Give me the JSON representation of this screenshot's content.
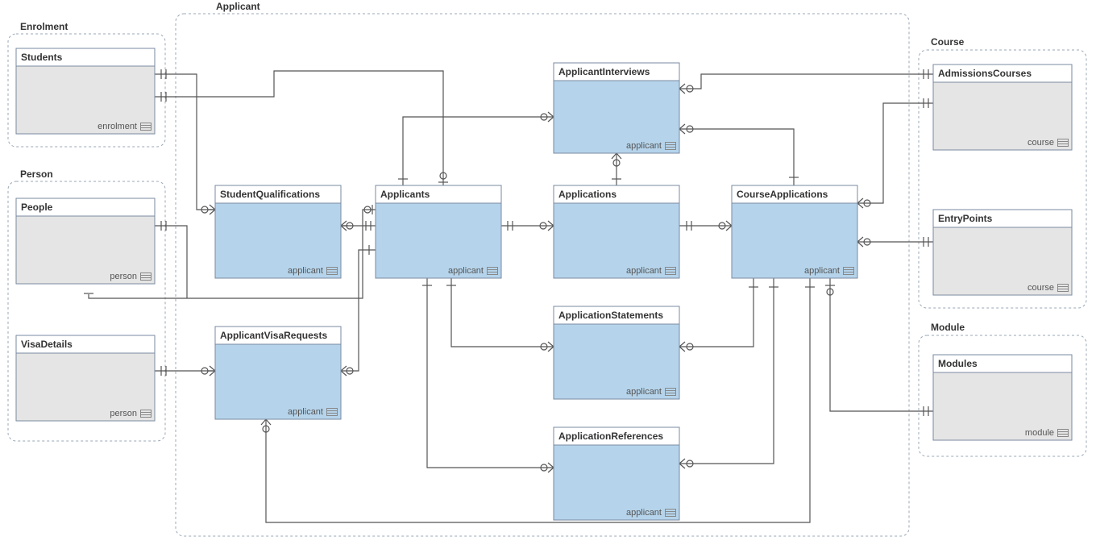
{
  "groups": {
    "enrolment": {
      "label": "Enrolment"
    },
    "person": {
      "label": "Person"
    },
    "applicant": {
      "label": "Applicant"
    },
    "course": {
      "label": "Course"
    },
    "module": {
      "label": "Module"
    }
  },
  "entities": {
    "students": {
      "title": "Students",
      "schema": "enrolment"
    },
    "people": {
      "title": "People",
      "schema": "person"
    },
    "visaDetails": {
      "title": "VisaDetails",
      "schema": "person"
    },
    "studentQualifications": {
      "title": "StudentQualifications",
      "schema": "applicant"
    },
    "applicants": {
      "title": "Applicants",
      "schema": "applicant"
    },
    "applicantVisaRequests": {
      "title": "ApplicantVisaRequests",
      "schema": "applicant"
    },
    "applicantInterviews": {
      "title": "ApplicantInterviews",
      "schema": "applicant"
    },
    "applications": {
      "title": "Applications",
      "schema": "applicant"
    },
    "applicationStatements": {
      "title": "ApplicationStatements",
      "schema": "applicant"
    },
    "applicationReferences": {
      "title": "ApplicationReferences",
      "schema": "applicant"
    },
    "courseApplications": {
      "title": "CourseApplications",
      "schema": "applicant"
    },
    "admissionsCourses": {
      "title": "AdmissionsCourses",
      "schema": "course"
    },
    "entryPoints": {
      "title": "EntryPoints",
      "schema": "course"
    },
    "modules": {
      "title": "Modules",
      "schema": "module"
    }
  }
}
